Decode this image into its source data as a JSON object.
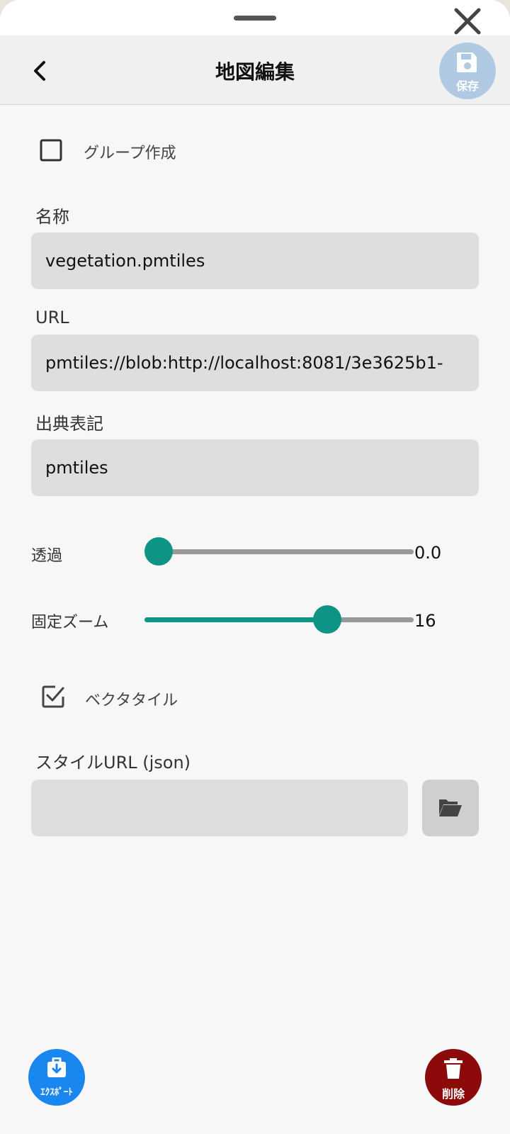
{
  "header": {
    "title": "地図編集",
    "save_label": "保存"
  },
  "group": {
    "label": "グループ作成",
    "checked": false
  },
  "fields": {
    "name": {
      "label": "名称",
      "value": "vegetation.pmtiles"
    },
    "url": {
      "label": "URL",
      "value": "pmtiles://blob:http://localhost:8081/3e3625b1-"
    },
    "attribution": {
      "label": "出典表記",
      "value": "pmtiles"
    }
  },
  "transparency": {
    "label": "透過",
    "value_text": "0.0",
    "fraction": 0.0
  },
  "fixed_zoom": {
    "label": "固定ズーム",
    "value_text": "16",
    "fraction": 0.7
  },
  "vector_tile": {
    "label": "ベクタタイル",
    "checked": true
  },
  "style_url": {
    "label": "スタイルURL (json)",
    "value": ""
  },
  "footer": {
    "export_label": "ｴｸｽﾎﾟｰﾄ",
    "delete_label": "削除"
  },
  "colors": {
    "accent": "#0e9484",
    "export": "#1a86f0",
    "delete": "#8c0a0a",
    "save": "#b0c9e2"
  }
}
